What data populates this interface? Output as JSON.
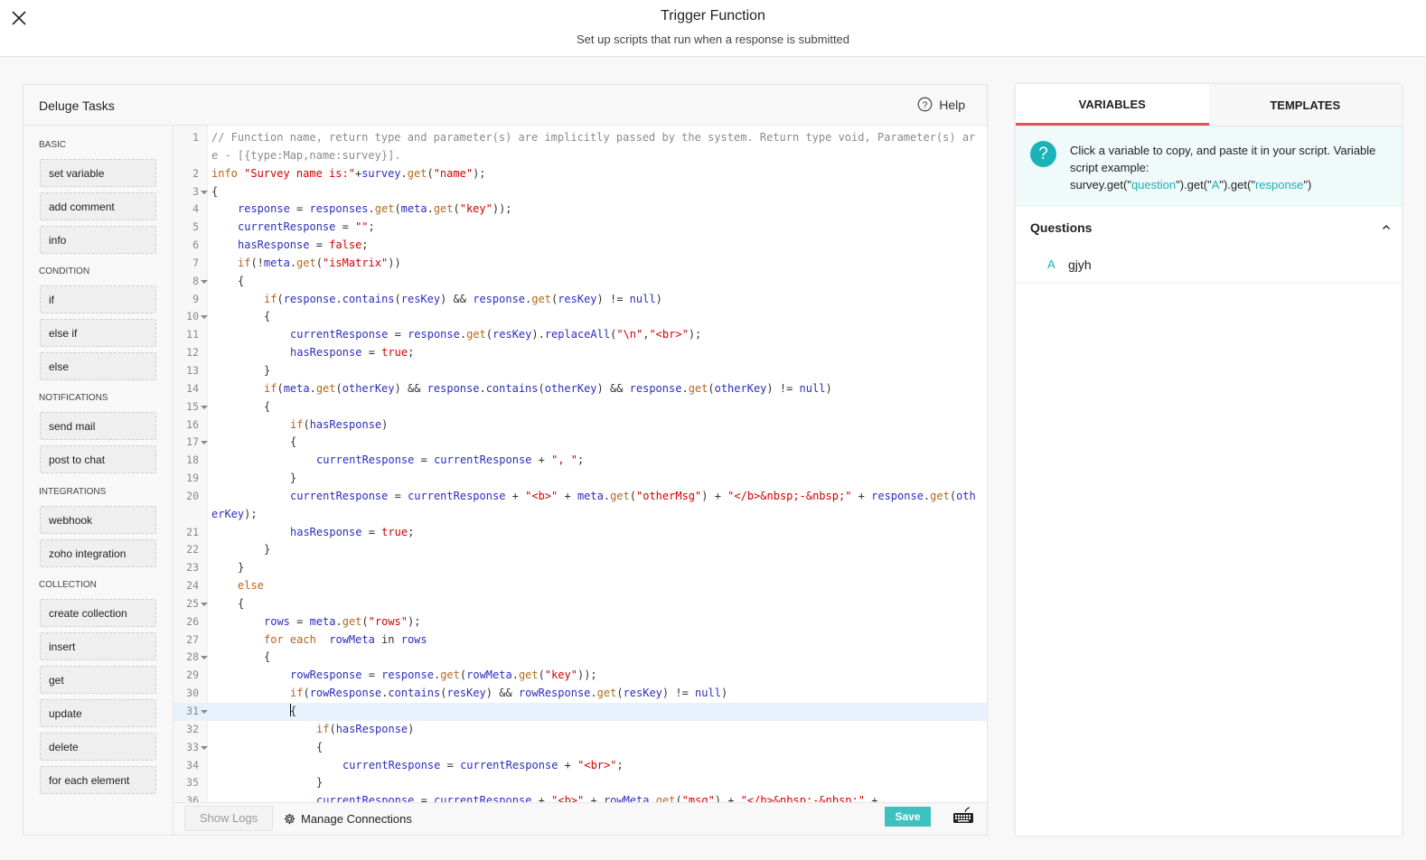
{
  "header": {
    "title": "Trigger Function",
    "subtitle": "Set up scripts that run when a response is submitted"
  },
  "main": {
    "title": "Deluge Tasks",
    "help_label": "Help"
  },
  "sidebar": {
    "categories": [
      {
        "label": "BASIC",
        "tasks": [
          "set variable",
          "add comment",
          "info"
        ]
      },
      {
        "label": "CONDITION",
        "tasks": [
          "if",
          "else if",
          "else"
        ]
      },
      {
        "label": "NOTIFICATIONS",
        "tasks": [
          "send mail",
          "post to chat"
        ]
      },
      {
        "label": "INTEGRATIONS",
        "tasks": [
          "webhook",
          "zoho integration"
        ]
      },
      {
        "label": "COLLECTION",
        "tasks": [
          "create collection",
          "insert",
          "get",
          "update",
          "delete",
          "for each element"
        ]
      }
    ]
  },
  "editor": {
    "active_line": 31,
    "fold_lines": [
      3,
      8,
      10,
      15,
      17,
      25,
      28,
      31,
      33
    ],
    "lines": [
      {
        "n": 1,
        "indent": 0,
        "tokens": [
          [
            "c",
            "// Function name, return type and parameter(s) are implicitly passed by the system. Return type void, Parameter(s) are - [{type:Map,name:survey}]."
          ]
        ]
      },
      {
        "n": 2,
        "indent": 0,
        "tokens": [
          [
            "kb",
            "info "
          ],
          [
            "s",
            "\"Survey name is:\""
          ],
          [
            "p",
            "+"
          ],
          [
            "v",
            "survey"
          ],
          [
            "p",
            "."
          ],
          [
            "f",
            "get"
          ],
          [
            "p",
            "("
          ],
          [
            "s",
            "\"name\""
          ],
          [
            "p",
            ");"
          ]
        ]
      },
      {
        "n": 3,
        "indent": 0,
        "tokens": [
          [
            "p",
            "{"
          ]
        ]
      },
      {
        "n": 4,
        "indent": 1,
        "tokens": [
          [
            "v",
            "response"
          ],
          [
            "p",
            " = "
          ],
          [
            "v",
            "responses"
          ],
          [
            "p",
            "."
          ],
          [
            "f",
            "get"
          ],
          [
            "p",
            "("
          ],
          [
            "v",
            "meta"
          ],
          [
            "p",
            "."
          ],
          [
            "f",
            "get"
          ],
          [
            "p",
            "("
          ],
          [
            "s",
            "\"key\""
          ],
          [
            "p",
            "));"
          ]
        ]
      },
      {
        "n": 5,
        "indent": 1,
        "tokens": [
          [
            "v",
            "currentResponse"
          ],
          [
            "p",
            " = "
          ],
          [
            "s",
            "\"\""
          ],
          [
            "p",
            ";"
          ]
        ]
      },
      {
        "n": 6,
        "indent": 1,
        "tokens": [
          [
            "v",
            "hasResponse"
          ],
          [
            "p",
            " = "
          ],
          [
            "b",
            "false"
          ],
          [
            "p",
            ";"
          ]
        ]
      },
      {
        "n": 7,
        "indent": 1,
        "tokens": [
          [
            "kb",
            "if"
          ],
          [
            "p",
            "(!"
          ],
          [
            "v",
            "meta"
          ],
          [
            "p",
            "."
          ],
          [
            "f",
            "get"
          ],
          [
            "p",
            "("
          ],
          [
            "s",
            "\"isMatrix\""
          ],
          [
            "p",
            "))"
          ]
        ]
      },
      {
        "n": 8,
        "indent": 1,
        "tokens": [
          [
            "p",
            "{"
          ]
        ]
      },
      {
        "n": 9,
        "indent": 2,
        "tokens": [
          [
            "kb",
            "if"
          ],
          [
            "p",
            "("
          ],
          [
            "v",
            "response"
          ],
          [
            "p",
            "."
          ],
          [
            "v",
            "contains"
          ],
          [
            "p",
            "("
          ],
          [
            "v",
            "resKey"
          ],
          [
            "p",
            ") && "
          ],
          [
            "v",
            "response"
          ],
          [
            "p",
            "."
          ],
          [
            "f",
            "get"
          ],
          [
            "p",
            "("
          ],
          [
            "v",
            "resKey"
          ],
          [
            "p",
            ") != "
          ],
          [
            "v",
            "null"
          ],
          [
            "p",
            ")"
          ]
        ]
      },
      {
        "n": 10,
        "indent": 2,
        "tokens": [
          [
            "p",
            "{"
          ]
        ]
      },
      {
        "n": 11,
        "indent": 3,
        "tokens": [
          [
            "v",
            "currentResponse"
          ],
          [
            "p",
            " = "
          ],
          [
            "v",
            "response"
          ],
          [
            "p",
            "."
          ],
          [
            "f",
            "get"
          ],
          [
            "p",
            "("
          ],
          [
            "v",
            "resKey"
          ],
          [
            "p",
            ")."
          ],
          [
            "v",
            "replaceAll"
          ],
          [
            "p",
            "("
          ],
          [
            "s",
            "\"\\n\""
          ],
          [
            "p",
            ","
          ],
          [
            "s",
            "\"<br>\""
          ],
          [
            "p",
            ");"
          ]
        ]
      },
      {
        "n": 12,
        "indent": 3,
        "tokens": [
          [
            "v",
            "hasResponse"
          ],
          [
            "p",
            " = "
          ],
          [
            "b",
            "true"
          ],
          [
            "p",
            ";"
          ]
        ]
      },
      {
        "n": 13,
        "indent": 2,
        "tokens": [
          [
            "p",
            "}"
          ]
        ]
      },
      {
        "n": 14,
        "indent": 2,
        "tokens": [
          [
            "kb",
            "if"
          ],
          [
            "p",
            "("
          ],
          [
            "v",
            "meta"
          ],
          [
            "p",
            "."
          ],
          [
            "f",
            "get"
          ],
          [
            "p",
            "("
          ],
          [
            "v",
            "otherKey"
          ],
          [
            "p",
            ") && "
          ],
          [
            "v",
            "response"
          ],
          [
            "p",
            "."
          ],
          [
            "v",
            "contains"
          ],
          [
            "p",
            "("
          ],
          [
            "v",
            "otherKey"
          ],
          [
            "p",
            ") && "
          ],
          [
            "v",
            "response"
          ],
          [
            "p",
            "."
          ],
          [
            "f",
            "get"
          ],
          [
            "p",
            "("
          ],
          [
            "v",
            "otherKey"
          ],
          [
            "p",
            ") != "
          ],
          [
            "v",
            "null"
          ],
          [
            "p",
            ")"
          ]
        ]
      },
      {
        "n": 15,
        "indent": 2,
        "tokens": [
          [
            "p",
            "{"
          ]
        ]
      },
      {
        "n": 16,
        "indent": 3,
        "tokens": [
          [
            "kb",
            "if"
          ],
          [
            "p",
            "("
          ],
          [
            "v",
            "hasResponse"
          ],
          [
            "p",
            ")"
          ]
        ]
      },
      {
        "n": 17,
        "indent": 3,
        "tokens": [
          [
            "p",
            "{"
          ]
        ]
      },
      {
        "n": 18,
        "indent": 4,
        "tokens": [
          [
            "v",
            "currentResponse"
          ],
          [
            "p",
            " = "
          ],
          [
            "v",
            "currentResponse"
          ],
          [
            "p",
            " + "
          ],
          [
            "s",
            "\", \""
          ],
          [
            "p",
            ";"
          ]
        ]
      },
      {
        "n": 19,
        "indent": 3,
        "tokens": [
          [
            "p",
            "}"
          ]
        ]
      },
      {
        "n": 20,
        "indent": 3,
        "tokens": [
          [
            "v",
            "currentResponse"
          ],
          [
            "p",
            " = "
          ],
          [
            "v",
            "currentResponse"
          ],
          [
            "p",
            " + "
          ],
          [
            "s",
            "\"<b>\""
          ],
          [
            "p",
            " + "
          ],
          [
            "v",
            "meta"
          ],
          [
            "p",
            "."
          ],
          [
            "f",
            "get"
          ],
          [
            "p",
            "("
          ],
          [
            "s",
            "\"otherMsg\""
          ],
          [
            "p",
            ") + "
          ],
          [
            "s",
            "\"</b>&nbsp;-&nbsp;\""
          ],
          [
            "p",
            " + "
          ],
          [
            "v",
            "response"
          ],
          [
            "p",
            "."
          ],
          [
            "f",
            "get"
          ],
          [
            "p",
            "("
          ],
          [
            "v",
            "otherKey"
          ],
          [
            "p",
            ");"
          ]
        ]
      },
      {
        "n": 21,
        "indent": 3,
        "tokens": [
          [
            "v",
            "hasResponse"
          ],
          [
            "p",
            " = "
          ],
          [
            "b",
            "true"
          ],
          [
            "p",
            ";"
          ]
        ]
      },
      {
        "n": 22,
        "indent": 2,
        "tokens": [
          [
            "p",
            "}"
          ]
        ]
      },
      {
        "n": 23,
        "indent": 1,
        "tokens": [
          [
            "p",
            "}"
          ]
        ]
      },
      {
        "n": 24,
        "indent": 1,
        "tokens": [
          [
            "kb",
            "else"
          ]
        ]
      },
      {
        "n": 25,
        "indent": 1,
        "tokens": [
          [
            "p",
            "{"
          ]
        ]
      },
      {
        "n": 26,
        "indent": 2,
        "tokens": [
          [
            "v",
            "rows"
          ],
          [
            "p",
            " = "
          ],
          [
            "v",
            "meta"
          ],
          [
            "p",
            "."
          ],
          [
            "f",
            "get"
          ],
          [
            "p",
            "("
          ],
          [
            "s",
            "\"rows\""
          ],
          [
            "p",
            ");"
          ]
        ]
      },
      {
        "n": 27,
        "indent": 2,
        "tokens": [
          [
            "kb",
            "for each  "
          ],
          [
            "v",
            "rowMeta"
          ],
          [
            "p",
            " in "
          ],
          [
            "v",
            "rows"
          ]
        ]
      },
      {
        "n": 28,
        "indent": 2,
        "tokens": [
          [
            "p",
            "{"
          ]
        ]
      },
      {
        "n": 29,
        "indent": 3,
        "tokens": [
          [
            "v",
            "rowResponse"
          ],
          [
            "p",
            " = "
          ],
          [
            "v",
            "response"
          ],
          [
            "p",
            "."
          ],
          [
            "f",
            "get"
          ],
          [
            "p",
            "("
          ],
          [
            "v",
            "rowMeta"
          ],
          [
            "p",
            "."
          ],
          [
            "f",
            "get"
          ],
          [
            "p",
            "("
          ],
          [
            "s",
            "\"key\""
          ],
          [
            "p",
            "));"
          ]
        ]
      },
      {
        "n": 30,
        "indent": 3,
        "tokens": [
          [
            "kb",
            "if"
          ],
          [
            "p",
            "("
          ],
          [
            "v",
            "rowResponse"
          ],
          [
            "p",
            "."
          ],
          [
            "v",
            "contains"
          ],
          [
            "p",
            "("
          ],
          [
            "v",
            "resKey"
          ],
          [
            "p",
            ") && "
          ],
          [
            "v",
            "rowResponse"
          ],
          [
            "p",
            "."
          ],
          [
            "f",
            "get"
          ],
          [
            "p",
            "("
          ],
          [
            "v",
            "resKey"
          ],
          [
            "p",
            ") != "
          ],
          [
            "v",
            "null"
          ],
          [
            "p",
            ")"
          ]
        ]
      },
      {
        "n": 31,
        "indent": 3,
        "tokens": [
          [
            "cursor",
            ""
          ],
          [
            "p",
            "{"
          ]
        ]
      },
      {
        "n": 32,
        "indent": 4,
        "tokens": [
          [
            "kb",
            "if"
          ],
          [
            "p",
            "("
          ],
          [
            "v",
            "hasResponse"
          ],
          [
            "p",
            ")"
          ]
        ]
      },
      {
        "n": 33,
        "indent": 4,
        "tokens": [
          [
            "p",
            "{"
          ]
        ]
      },
      {
        "n": 34,
        "indent": 5,
        "tokens": [
          [
            "v",
            "currentResponse"
          ],
          [
            "p",
            " = "
          ],
          [
            "v",
            "currentResponse"
          ],
          [
            "p",
            " + "
          ],
          [
            "s",
            "\"<br>\""
          ],
          [
            "p",
            ";"
          ]
        ]
      },
      {
        "n": 35,
        "indent": 4,
        "tokens": [
          [
            "p",
            "}"
          ]
        ]
      },
      {
        "n": 36,
        "indent": 4,
        "tokens": [
          [
            "v",
            "currentResponse"
          ],
          [
            "p",
            " = "
          ],
          [
            "v",
            "currentResponse"
          ],
          [
            "p",
            " + "
          ],
          [
            "s",
            "\"<b>\""
          ],
          [
            "p",
            " + "
          ],
          [
            "v",
            "rowMeta"
          ],
          [
            "p",
            "."
          ],
          [
            "f",
            "get"
          ],
          [
            "p",
            "("
          ],
          [
            "s",
            "\"msg\""
          ],
          [
            "p",
            ") + "
          ],
          [
            "s",
            "\"</b>&nbsp;-&nbsp;\""
          ],
          [
            "p",
            " +"
          ]
        ]
      }
    ]
  },
  "footer": {
    "show_logs_label": "Show Logs",
    "manage_connections_label": "Manage Connections",
    "save_label": "Save"
  },
  "right_panel": {
    "tabs": [
      {
        "label": "VARIABLES",
        "active": true
      },
      {
        "label": "TEMPLATES",
        "active": false
      }
    ],
    "info": {
      "icon": "?",
      "text": "Click a variable to copy, and paste it in your script. Variable script example:",
      "example_parts": [
        {
          "text": "survey.get(\"",
          "hl": false
        },
        {
          "text": "question",
          "hl": true
        },
        {
          "text": "\").get(\"",
          "hl": false
        },
        {
          "text": "A",
          "hl": true
        },
        {
          "text": "\").get(\"",
          "hl": false
        },
        {
          "text": "response",
          "hl": true
        },
        {
          "text": "\")",
          "hl": false
        }
      ]
    },
    "questions": {
      "title": "Questions",
      "items": [
        {
          "letter": "A",
          "text": "gjyh"
        }
      ]
    }
  },
  "colors": {
    "accent_teal": "#3ec2c0",
    "tab_active_underline": "#e2525c",
    "info_teal": "#19b3b8"
  }
}
